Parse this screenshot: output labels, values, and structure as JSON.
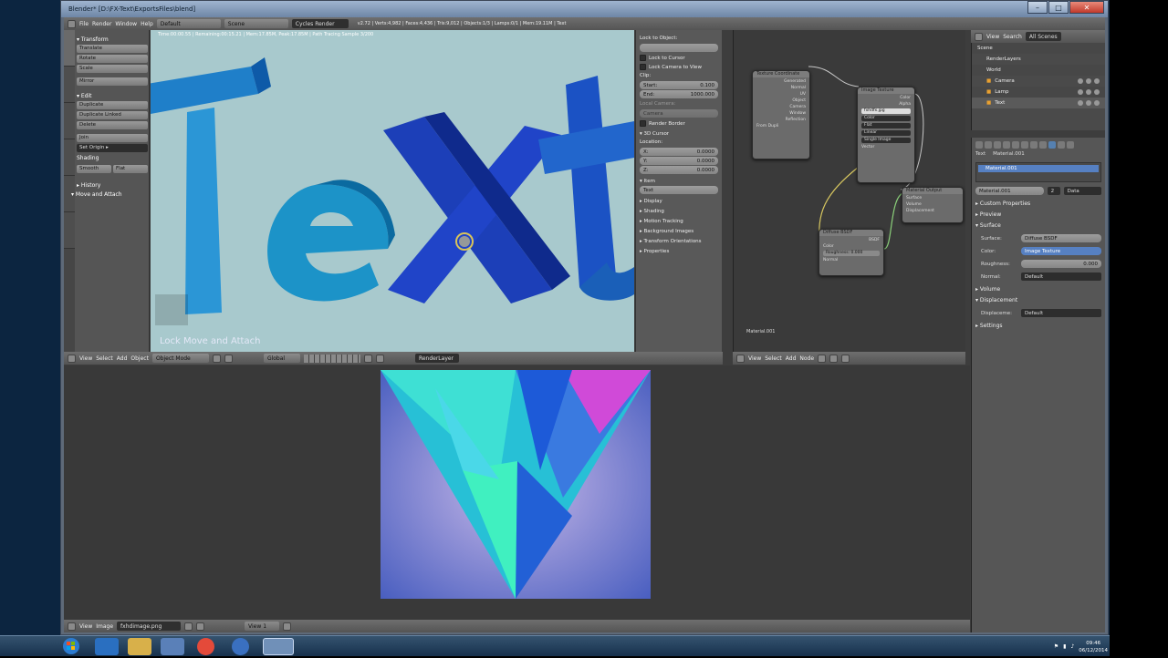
{
  "window": {
    "title": "Blender* [D:\\FX-Text\\ExportsFiles\\blend]",
    "min": "–",
    "max": "□",
    "close": "✕"
  },
  "menu": {
    "items": [
      "File",
      "Render",
      "Window",
      "Help"
    ],
    "screen": "Default",
    "scene": "Scene",
    "engine": "Cycles Render",
    "stats": "v2.72 | Verts:4,982 | Faces:4,436 | Tris:9,012 | Objects:1/3 | Lamps:0/1 | Mem:19.11M | Text"
  },
  "toolshelf": {
    "transform_title": "▾ Transform",
    "transform": [
      "Translate",
      "Rotate",
      "Scale",
      "Mirror"
    ],
    "edit_title": "▾ Edit",
    "edit": [
      "Duplicate",
      "Duplicate Linked",
      "Delete",
      "Join"
    ],
    "set_origin": "Set Origin ▸",
    "shading_title": "Shading",
    "shading": [
      "Smooth",
      "Flat"
    ],
    "history": "▸ History",
    "operator": "▾ Move and Attach",
    "tabs": [
      "Tools",
      "Create",
      "Relations",
      "Animation",
      "Physics",
      "Grease Pencil"
    ]
  },
  "viewport": {
    "info": "Time:00:00.55 | Remaining:00:15.21 | Mem:17.85M, Peak:17.85M | Path Tracing Sample 3/200",
    "text_shape": "Text",
    "last_op": "Lock Move and Attach"
  },
  "npanel": {
    "lock_obj": "Lock to Object:",
    "lock_cursor": "Lock to Cursor",
    "lock_camera": "Lock Camera to View",
    "clip": "Clip:",
    "start_label": "Start:",
    "start": "0.100",
    "end_label": "End:",
    "end": "1000.000",
    "local_camera": "Local Camera:",
    "camera": "Camera",
    "render_border": "Render Border",
    "cursor3d": "▾ 3D Cursor",
    "location": "Location:",
    "x_label": "X:",
    "x": "0.0000",
    "y_label": "Y:",
    "y": "0.0000",
    "z_label": "Z:",
    "z": "0.0000",
    "item": "▾ Item",
    "item_name": "Text",
    "sections": [
      "▸ Display",
      "▸ Shading",
      "▸ Motion Tracking",
      "▸ Background Images",
      "▸ Transform Orientations",
      "▸ Properties"
    ]
  },
  "viewport_header": {
    "items": [
      "View",
      "Select",
      "Add",
      "Object"
    ],
    "mode": "Object Mode",
    "orientation": "Global",
    "layer": "RenderLayer"
  },
  "nodes": {
    "tex_coord": {
      "title": "Texture Coordinate",
      "outs": [
        "Generated",
        "Normal",
        "UV",
        "Object",
        "Camera",
        "Window",
        "Reflection"
      ],
      "from_dupli": "From Dupli"
    },
    "image_tex": {
      "title": "Image Texture",
      "outs": [
        "Color",
        "Alpha"
      ],
      "file": "fxhdfx.jpg",
      "opts": [
        "Color",
        "Flat",
        "Linear",
        "Single Image"
      ],
      "vector": "Vector"
    },
    "diffuse": {
      "title": "Diffuse BSDF",
      "out": "BSDF",
      "color": "Color",
      "roughness": "Roughness: 0.000",
      "normal": "Normal"
    },
    "output": {
      "title": "Material Output",
      "ins": [
        "Surface",
        "Volume",
        "Displacement"
      ]
    },
    "mat_label": "Material.001",
    "header": [
      "View",
      "Select",
      "Add",
      "Node"
    ]
  },
  "outliner": {
    "header": [
      "View",
      "Search",
      "All Scenes"
    ],
    "rows": [
      "Scene",
      "RenderLayers",
      "World",
      "Camera",
      "Lamp",
      "Text"
    ]
  },
  "props": {
    "breadcrumb": [
      "Text",
      "Material.001"
    ],
    "slot": "Material.001",
    "mat_field": "Material.001",
    "mat_num": "2",
    "data": "Data",
    "sections": {
      "custom": "▸ Custom Properties",
      "preview": "▸ Preview",
      "surface": "▾ Surface"
    },
    "surface_label": "Surface:",
    "surface": "Diffuse BSDF",
    "color_label": "Color:",
    "color": "Image Texture",
    "rough_label": "Roughness:",
    "rough": "0.000",
    "normal_label": "Normal:",
    "normal": "Default",
    "volume": "▸ Volume",
    "disp": "▾ Displacement",
    "disp_label": "Displaceme:",
    "disp_val": "Default",
    "settings": "▸ Settings"
  },
  "image_editor": {
    "header": [
      "View",
      "Image"
    ],
    "image": "fxhdimage.png",
    "slot": "View 1"
  },
  "taskbar": {
    "time": "09:46",
    "date": "06/12/2014"
  },
  "colors": {
    "accent": "#5680c2",
    "viewport_bg": "#a8c9cd"
  }
}
